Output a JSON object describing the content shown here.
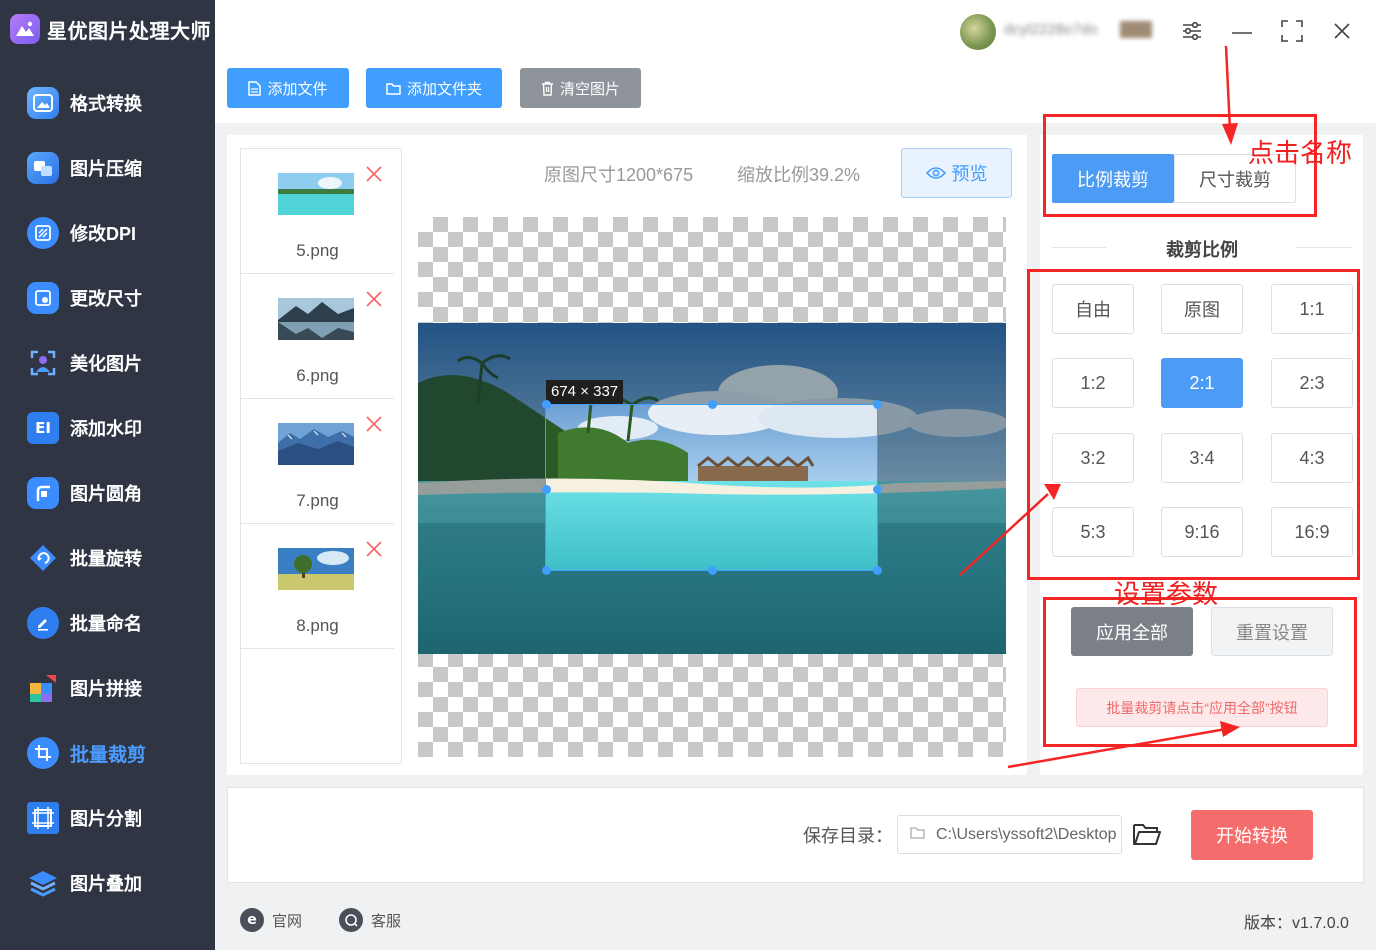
{
  "app": {
    "title": "星优图片处理大师"
  },
  "user": {
    "name": "dcyl2228o7do"
  },
  "sidebar": {
    "items": [
      {
        "label": "格式转换",
        "icon": "image-convert-icon"
      },
      {
        "label": "图片压缩",
        "icon": "image-compress-icon"
      },
      {
        "label": "修改DPI",
        "icon": "dpi-icon"
      },
      {
        "label": "更改尺寸",
        "icon": "resize-icon"
      },
      {
        "label": "美化图片",
        "icon": "beautify-icon"
      },
      {
        "label": "添加水印",
        "icon": "watermark-icon"
      },
      {
        "label": "图片圆角",
        "icon": "rounded-corner-icon"
      },
      {
        "label": "批量旋转",
        "icon": "rotate-icon"
      },
      {
        "label": "批量命名",
        "icon": "rename-icon"
      },
      {
        "label": "图片拼接",
        "icon": "puzzle-icon"
      },
      {
        "label": "批量裁剪",
        "icon": "crop-icon",
        "active": true
      },
      {
        "label": "图片分割",
        "icon": "split-icon"
      },
      {
        "label": "图片叠加",
        "icon": "layers-icon"
      }
    ]
  },
  "toolbar": {
    "add_file": "添加文件",
    "add_folder": "添加文件夹",
    "clear_images": "清空图片"
  },
  "files": [
    {
      "name": "5.png"
    },
    {
      "name": "6.png"
    },
    {
      "name": "7.png"
    },
    {
      "name": "8.png"
    }
  ],
  "preview": {
    "original_size": "原图尺寸1200*675",
    "zoom_ratio": "缩放比例39.2%",
    "preview_label": "预览",
    "crop_size": "674 × 337"
  },
  "crop": {
    "tabs": [
      "比例裁剪",
      "尺寸裁剪"
    ],
    "active_tab": "比例裁剪",
    "ratio_title": "裁剪比例",
    "ratios": [
      "自由",
      "原图",
      "1:1",
      "1:2",
      "2:1",
      "2:3",
      "3:2",
      "3:4",
      "4:3",
      "5:3",
      "9:16",
      "16:9"
    ],
    "selected_ratio": "2:1",
    "apply_all": "应用全部",
    "reset": "重置设置",
    "batch_tip": "批量裁剪请点击“应用全部”按钮"
  },
  "save": {
    "label": "保存目录：",
    "path": "C:\\Users\\yssoft2\\Desktop"
  },
  "start_button": "开始转换",
  "footer": {
    "official_site": "官网",
    "support": "客服",
    "version": "版本：v1.7.0.0"
  },
  "annotations": {
    "click_name": "点击名称",
    "set_params": "设置参数"
  },
  "colors": {
    "sidebar_bg": "#2f3542",
    "accent_blue": "#4c9bf5",
    "start_red": "#f56c6c",
    "annotation_red": "#f52525"
  }
}
